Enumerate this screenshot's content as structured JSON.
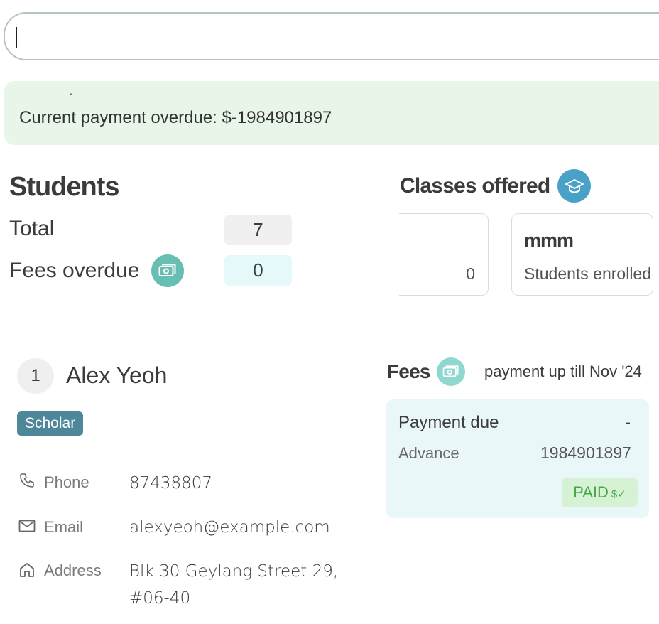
{
  "command_box": {
    "value": "",
    "placeholder": ""
  },
  "result": {
    "marker": ".",
    "message": "Current payment overdue: $-1984901897"
  },
  "students": {
    "title": "Students",
    "total_label": "Total",
    "total_value": "7",
    "overdue_label": "Fees overdue",
    "overdue_value": "0",
    "overdue_icon": "money-icon"
  },
  "classes": {
    "title": "Classes offered",
    "icon": "graduation-cap-icon",
    "cards": [
      {
        "name": "",
        "count": "0"
      },
      {
        "name": "mmm",
        "subtitle": "Students enrolled"
      }
    ]
  },
  "student": {
    "index": "1",
    "name": "Alex Yeoh",
    "tag": "Scholar",
    "phone_label": "Phone",
    "phone": "87438807",
    "email_label": "Email",
    "email": "alexyeoh@example.com",
    "address_label": "Address",
    "address_line1": "Blk 30 Geylang Street 29,",
    "address_line2": "#06-40"
  },
  "fees": {
    "title": "Fees",
    "subtitle": "payment up till Nov '24",
    "payment_due_label": "Payment due",
    "payment_due_value": "-",
    "advance_label": "Advance",
    "advance_value": "1984901897",
    "status": "PAID",
    "status_symbol": "$✓"
  },
  "colors": {
    "banner_bg": "#e8f5e9",
    "tag_bg": "#4e869a",
    "paid_text": "#4aa64a",
    "paid_bg": "#d6f2d4",
    "classes_icon_bg": "#4aa1c8",
    "money_icon_bg": "#66bfb2"
  }
}
